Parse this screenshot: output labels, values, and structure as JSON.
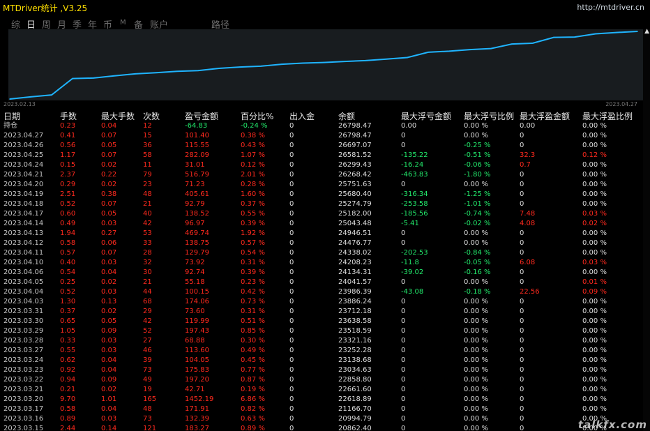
{
  "title_bar": {
    "app_title": "MTDriver统计 ,V3.25",
    "site_url": "http://mtdriver.cn"
  },
  "period_tabs": [
    {
      "label": "综",
      "active": false
    },
    {
      "label": "日",
      "active": true
    },
    {
      "label": "周",
      "active": false
    },
    {
      "label": "月",
      "active": false
    },
    {
      "label": "季",
      "active": false
    },
    {
      "label": "年",
      "active": false
    },
    {
      "label": "币",
      "active": false
    },
    {
      "label": "M",
      "active": false
    },
    {
      "label": "备",
      "active": false
    },
    {
      "label": "账户",
      "active": false
    },
    {
      "label": "路径",
      "active": false
    }
  ],
  "chart_data": {
    "type": "line",
    "x_start_label": "2023.02.13",
    "x_end_label": "2023.04.27",
    "series": [
      {
        "color": "#1fb4ff",
        "values": [
          20800,
          20994.79,
          21166.7,
          22618.89,
          22661.6,
          22858.8,
          23034.63,
          23138.68,
          23252.28,
          23321.16,
          23518.59,
          23638.58,
          23712.18,
          23886.24,
          23986.39,
          24041.57,
          24134.31,
          24208.23,
          24338.02,
          24476.77,
          24946.51,
          25043.48,
          25182.0,
          25274.79,
          25680.4,
          25751.63,
          26268.42,
          26299.43,
          26581.52,
          26697.07,
          26798.47
        ]
      }
    ]
  },
  "table": {
    "headers": [
      "日期",
      "手数",
      "最大手数",
      "次数",
      "盈亏金额",
      "百分比%",
      "出入金",
      "余额",
      "最大浮亏金额",
      "最大浮亏比例",
      "最大浮盈金额",
      "最大浮盈比例"
    ],
    "hold_row": [
      "持仓",
      "0.23",
      "0.04",
      "12",
      "-64.83",
      "-0.24 %",
      "0",
      "26798.47",
      "0.00",
      "0.00 %",
      "0.00",
      "0.00 %"
    ],
    "rows": [
      [
        "2023.04.27",
        "0.41",
        "0.07",
        "15",
        "101.40",
        "0.38 %",
        "0",
        "26798.47",
        "0",
        "0.00 %",
        "0",
        "0.00 %"
      ],
      [
        "2023.04.26",
        "0.56",
        "0.05",
        "36",
        "115.55",
        "0.43 %",
        "0",
        "26697.07",
        "0",
        "-0.25 %",
        "0",
        "0.00 %"
      ],
      [
        "2023.04.25",
        "1.17",
        "0.07",
        "58",
        "282.09",
        "1.07 %",
        "0",
        "26581.52",
        "-135.22",
        "-0.51 %",
        "32.3",
        "0.12 %"
      ],
      [
        "2023.04.24",
        "0.15",
        "0.02",
        "11",
        "31.01",
        "0.12 %",
        "0",
        "26299.43",
        "-16.24",
        "-0.06 %",
        "0.7",
        "0.00 %"
      ],
      [
        "2023.04.21",
        "2.37",
        "0.22",
        "79",
        "516.79",
        "2.01 %",
        "0",
        "26268.42",
        "-463.83",
        "-1.80 %",
        "0",
        "0.00 %"
      ],
      [
        "2023.04.20",
        "0.29",
        "0.02",
        "23",
        "71.23",
        "0.28 %",
        "0",
        "25751.63",
        "0",
        "0.00 %",
        "0",
        "0.00 %"
      ],
      [
        "2023.04.19",
        "2.51",
        "0.38",
        "48",
        "405.61",
        "1.60 %",
        "0",
        "25680.40",
        "-316.34",
        "-1.25 %",
        "0",
        "0.00 %"
      ],
      [
        "2023.04.18",
        "0.52",
        "0.07",
        "21",
        "92.79",
        "0.37 %",
        "0",
        "25274.79",
        "-253.58",
        "-1.01 %",
        "0",
        "0.00 %"
      ],
      [
        "2023.04.17",
        "0.60",
        "0.05",
        "40",
        "138.52",
        "0.55 %",
        "0",
        "25182.00",
        "-185.56",
        "-0.74 %",
        "7.48",
        "0.03 %"
      ],
      [
        "2023.04.14",
        "0.49",
        "0.03",
        "42",
        "96.97",
        "0.39 %",
        "0",
        "25043.48",
        "-5.41",
        "-0.02 %",
        "4.08",
        "0.02 %"
      ],
      [
        "2023.04.13",
        "1.94",
        "0.27",
        "53",
        "469.74",
        "1.92 %",
        "0",
        "24946.51",
        "0",
        "0.00 %",
        "0",
        "0.00 %"
      ],
      [
        "2023.04.12",
        "0.58",
        "0.06",
        "33",
        "138.75",
        "0.57 %",
        "0",
        "24476.77",
        "0",
        "0.00 %",
        "0",
        "0.00 %"
      ],
      [
        "2023.04.11",
        "0.57",
        "0.07",
        "28",
        "129.79",
        "0.54 %",
        "0",
        "24338.02",
        "-202.53",
        "-0.84 %",
        "0",
        "0.00 %"
      ],
      [
        "2023.04.10",
        "0.40",
        "0.03",
        "32",
        "73.92",
        "0.31 %",
        "0",
        "24208.23",
        "-11.8",
        "-0.05 %",
        "6.08",
        "0.03 %"
      ],
      [
        "2023.04.06",
        "0.54",
        "0.04",
        "30",
        "92.74",
        "0.39 %",
        "0",
        "24134.31",
        "-39.02",
        "-0.16 %",
        "0",
        "0.00 %"
      ],
      [
        "2023.04.05",
        "0.25",
        "0.02",
        "21",
        "55.18",
        "0.23 %",
        "0",
        "24041.57",
        "0",
        "0.00 %",
        "0",
        "0.01 %"
      ],
      [
        "2023.04.04",
        "0.52",
        "0.03",
        "44",
        "100.15",
        "0.42 %",
        "0",
        "23986.39",
        "-43.08",
        "-0.18 %",
        "22.56",
        "0.09 %"
      ],
      [
        "2023.04.03",
        "1.30",
        "0.13",
        "68",
        "174.06",
        "0.73 %",
        "0",
        "23886.24",
        "0",
        "0.00 %",
        "0",
        "0.00 %"
      ],
      [
        "2023.03.31",
        "0.37",
        "0.02",
        "29",
        "73.60",
        "0.31 %",
        "0",
        "23712.18",
        "0",
        "0.00 %",
        "0",
        "0.00 %"
      ],
      [
        "2023.03.30",
        "0.65",
        "0.05",
        "42",
        "119.99",
        "0.51 %",
        "0",
        "23638.58",
        "0",
        "0.00 %",
        "0",
        "0.00 %"
      ],
      [
        "2023.03.29",
        "1.05",
        "0.09",
        "52",
        "197.43",
        "0.85 %",
        "0",
        "23518.59",
        "0",
        "0.00 %",
        "0",
        "0.00 %"
      ],
      [
        "2023.03.28",
        "0.33",
        "0.03",
        "27",
        "68.88",
        "0.30 %",
        "0",
        "23321.16",
        "0",
        "0.00 %",
        "0",
        "0.00 %"
      ],
      [
        "2023.03.27",
        "0.55",
        "0.03",
        "46",
        "113.60",
        "0.49 %",
        "0",
        "23252.28",
        "0",
        "0.00 %",
        "0",
        "0.00 %"
      ],
      [
        "2023.03.24",
        "0.62",
        "0.04",
        "39",
        "104.05",
        "0.45 %",
        "0",
        "23138.68",
        "0",
        "0.00 %",
        "0",
        "0.00 %"
      ],
      [
        "2023.03.23",
        "0.92",
        "0.04",
        "73",
        "175.83",
        "0.77 %",
        "0",
        "23034.63",
        "0",
        "0.00 %",
        "0",
        "0.00 %"
      ],
      [
        "2023.03.22",
        "0.94",
        "0.09",
        "49",
        "197.20",
        "0.87 %",
        "0",
        "22858.80",
        "0",
        "0.00 %",
        "0",
        "0.00 %"
      ],
      [
        "2023.03.21",
        "0.21",
        "0.02",
        "19",
        "42.71",
        "0.19 %",
        "0",
        "22661.60",
        "0",
        "0.00 %",
        "0",
        "0.00 %"
      ],
      [
        "2023.03.20",
        "9.70",
        "1.01",
        "165",
        "1452.19",
        "6.86 %",
        "0",
        "22618.89",
        "0",
        "0.00 %",
        "0",
        "0.00 %"
      ],
      [
        "2023.03.17",
        "0.58",
        "0.04",
        "48",
        "171.91",
        "0.82 %",
        "0",
        "21166.70",
        "0",
        "0.00 %",
        "0",
        "0.00 %"
      ],
      [
        "2023.03.16",
        "0.89",
        "0.03",
        "73",
        "132.39",
        "0.63 %",
        "0",
        "20994.79",
        "0",
        "0.00 %",
        "0",
        "0.00 %"
      ],
      [
        "2023.03.15",
        "2.44",
        "0.14",
        "121",
        "183.27",
        "0.89 %",
        "0",
        "20862.40",
        "0",
        "0.00 %",
        "0",
        "0.00 %"
      ]
    ]
  },
  "scrollbar": {
    "up_icon": "▲"
  },
  "watermark": "talkfx.com",
  "colors": {
    "title": "#ffe000",
    "profit": "#ff2a1e",
    "loss": "#22e86b",
    "line": "#1fb4ff",
    "text": "#dcdcdc"
  }
}
